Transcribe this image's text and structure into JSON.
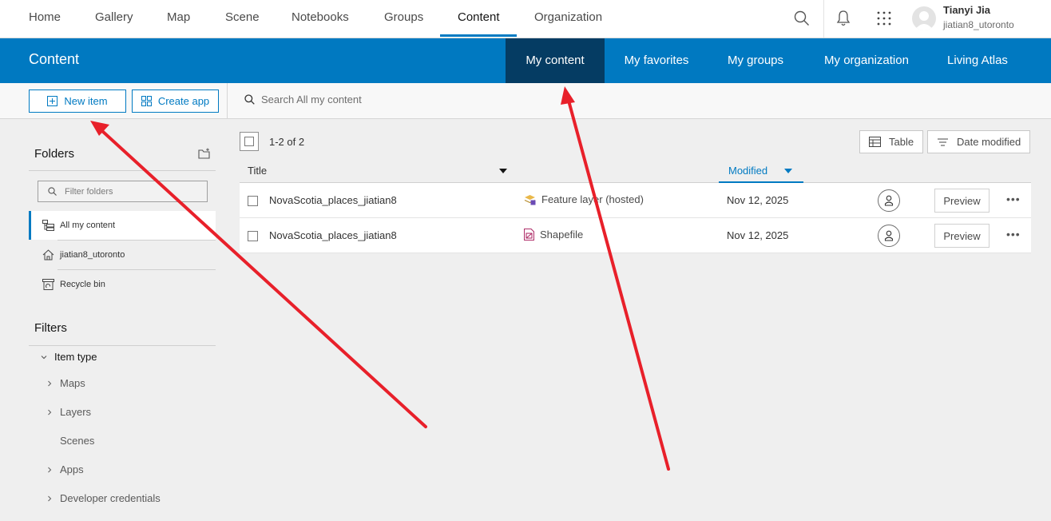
{
  "topnav": {
    "items": [
      "Home",
      "Gallery",
      "Map",
      "Scene",
      "Notebooks",
      "Groups",
      "Content",
      "Organization"
    ],
    "active": "Content"
  },
  "user": {
    "name": "Tianyi Jia",
    "username": "jiatian8_utoronto"
  },
  "header": {
    "title": "Content",
    "tabs": [
      "My content",
      "My favorites",
      "My groups",
      "My organization",
      "Living Atlas"
    ],
    "active_tab": "My content"
  },
  "toolbar": {
    "new_item": "New item",
    "create_app": "Create app",
    "search_placeholder": "Search All my content"
  },
  "sidebar": {
    "folders_title": "Folders",
    "filter_placeholder": "Filter folders",
    "folders": [
      "All my content",
      "jiatian8_utoronto",
      "Recycle bin"
    ],
    "filters_title": "Filters",
    "item_type_label": "Item type",
    "item_types": [
      "Maps",
      "Layers",
      "Scenes",
      "Apps",
      "Developer credentials"
    ]
  },
  "list": {
    "count": "1-2 of 2",
    "table_label": "Table",
    "sort_label": "Date modified",
    "columns": {
      "title": "Title",
      "modified": "Modified"
    },
    "rows": [
      {
        "title": "NovaScotia_places_jiatian8",
        "type": "Feature layer (hosted)",
        "modified": "Nov 12, 2025",
        "preview": "Preview"
      },
      {
        "title": "NovaScotia_places_jiatian8",
        "type": "Shapefile",
        "modified": "Nov 12, 2025",
        "preview": "Preview"
      }
    ]
  },
  "colors": {
    "brand_blue": "#0079c1",
    "active_tab": "#053c63",
    "annotation_red": "#e8202a"
  },
  "icons": [
    "search-icon",
    "bell-icon",
    "app-launcher-icon",
    "avatar",
    "plus-square-icon",
    "grid-icon",
    "new-folder-icon",
    "folder-tree-icon",
    "home-folder-icon",
    "recycle-bin-icon",
    "chevron-down-icon",
    "chevron-right-icon",
    "feature-layer-icon",
    "shapefile-icon",
    "user-share-icon",
    "more-icon",
    "table-icon",
    "sort-icon"
  ]
}
